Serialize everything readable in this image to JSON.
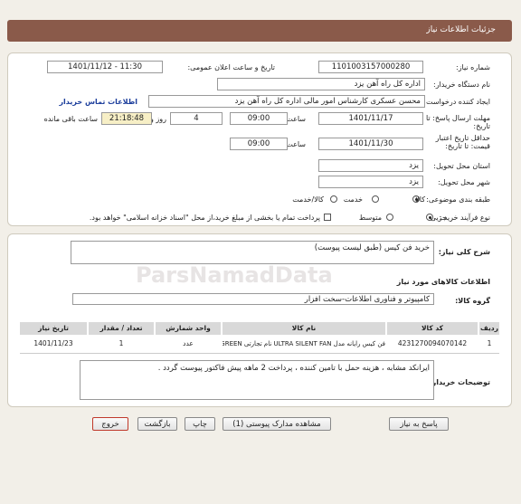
{
  "header": {
    "title": "جزئیات اطلاعات نیاز"
  },
  "form": {
    "need_number_label": "شماره نیاز:",
    "need_number": "1101003157000280",
    "announce_label": "تاریخ و ساعت اعلان عمومی:",
    "announce_value": "1401/11/12 - 11:30",
    "buyer_org_label": "نام دستگاه خریدار:",
    "buyer_org": "اداره کل راه آهن یزد",
    "creator_label": "ایجاد کننده درخواست:",
    "creator": "محسن عسکری کارشناس امور مالی اداره کل راه آهن یزد",
    "contact_link": "اطلاعات تماس خریدار",
    "reply_deadline_label": "مهلت ارسال پاسخ: تا تاریخ:",
    "reply_date": "1401/11/17",
    "time_label": "ساعت",
    "reply_time": "09:00",
    "days_value": "4",
    "days_label": "روز و",
    "remaining_time": "21:18:48",
    "remaining_label": "ساعت باقی مانده",
    "validity_label": "حداقل تاریخ اعتبار قیمت: تا تاریخ:",
    "validity_date": "1401/11/30",
    "validity_time": "09:00",
    "province_label": "استان محل تحویل:",
    "province": "یزد",
    "city_label": "شهر محل تحویل:",
    "city": "یزد",
    "category_label": "طبقه بندی موضوعی:",
    "category_options": [
      "کالا",
      "خدمت",
      "کالا/خدمت"
    ],
    "purchase_type_label": "نوع فرآیند خرید :",
    "purchase_options": [
      "جزیی",
      "متوسط"
    ],
    "payment_note": "پرداخت تمام یا بخشی از مبلغ خرید،از محل \"اسناد خزانه اسلامی\" خواهد بود."
  },
  "details": {
    "summary_label": "شرح کلی نیاز:",
    "summary": "خرید فن کیس (طبق لیست پیوست)",
    "goods_title": "اطلاعات کالاهای مورد نیاز",
    "group_label": "گروه کالا:",
    "group": "کامپیوتر و فناوری اطلاعات-سخت افزار",
    "table": {
      "headers": [
        "ردیف",
        "کد کالا",
        "نام کالا",
        "واحد شمارش",
        "تعداد / مقدار",
        "تاریخ نیاز"
      ],
      "rows": [
        {
          "index": "1",
          "code": "4231270094070142",
          "name": "فن کیس رایانه مدل ULTRA SILENT FAN نام تجارتی GREEN",
          "unit": "عدد",
          "qty": "1",
          "date": "1401/11/23"
        }
      ]
    },
    "buyer_notes_label": "توضیحات خریدار:",
    "buyer_notes": "ایرانکد مشابه ، هزینه حمل با تامین کننده ، پرداخت 2 ماهه پیش فاکتور پیوست گردد ."
  },
  "buttons": {
    "reply": "پاسخ به نیاز",
    "view_docs": "مشاهده مدارک پیوستی (1)",
    "print": "چاپ",
    "back": "بازگشت",
    "exit": "خروج"
  },
  "watermark": {
    "text": "ParsNamadData"
  },
  "colors": {
    "header_bg": "#8a5a4a",
    "link": "#1c3e9c",
    "exit_border": "#c0392b"
  }
}
